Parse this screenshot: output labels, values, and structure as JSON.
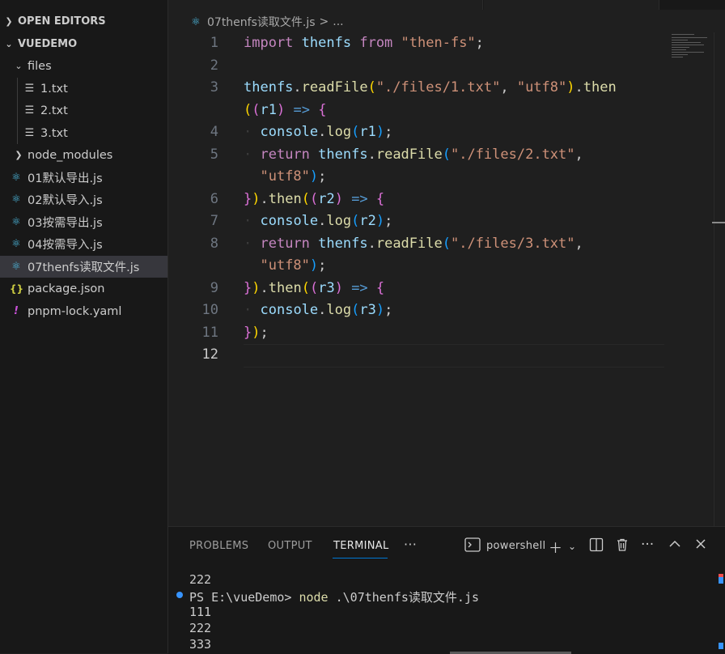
{
  "explorer": {
    "open_editors_label": "OPEN EDITORS",
    "project_label": "VUEDEMO",
    "items": [
      {
        "label": "files",
        "type": "folder-open"
      },
      {
        "label": "1.txt",
        "type": "txt"
      },
      {
        "label": "2.txt",
        "type": "txt"
      },
      {
        "label": "3.txt",
        "type": "txt"
      },
      {
        "label": "node_modules",
        "type": "folder-closed"
      },
      {
        "label": "01默认导出.js",
        "type": "react"
      },
      {
        "label": "02默认导入.js",
        "type": "react"
      },
      {
        "label": "03按需导出.js",
        "type": "react"
      },
      {
        "label": "04按需导入.js",
        "type": "react"
      },
      {
        "label": "07thenfs读取文件.js",
        "type": "react",
        "active": true
      },
      {
        "label": "package.json",
        "type": "json"
      },
      {
        "label": "pnpm-lock.yaml",
        "type": "yaml"
      }
    ]
  },
  "breadcrumb": {
    "file": "07thenfs读取文件.js",
    "sep": ">",
    "rest": "..."
  },
  "editor": {
    "line_numbers": [
      "1",
      "2",
      "3",
      "",
      "4",
      "5",
      "",
      "6",
      "7",
      "8",
      "",
      "9",
      "10",
      "11",
      "12"
    ],
    "current_line": "12"
  },
  "panel": {
    "tabs": [
      "PROBLEMS",
      "OUTPUT",
      "TERMINAL"
    ],
    "active_tab": "TERMINAL",
    "more": "···",
    "shell_label": "powershell",
    "terminal": {
      "line1": "222",
      "prompt": "PS E:\\vueDemo> ",
      "command": "node",
      "args": " .\\07thenfs读取文件.js",
      "out1": "111",
      "out2": "222",
      "out3": "333"
    }
  }
}
